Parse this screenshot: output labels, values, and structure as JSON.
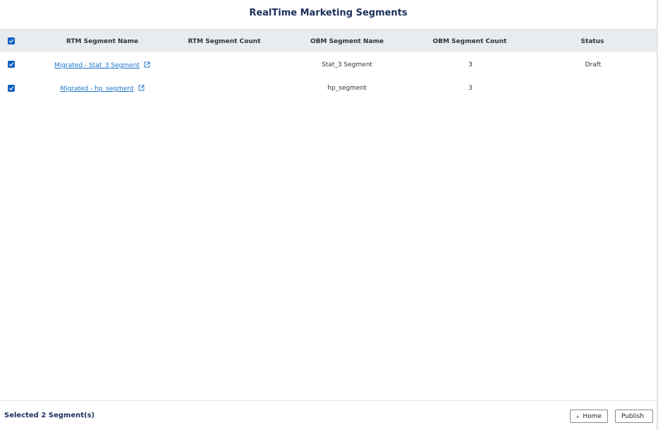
{
  "page": {
    "title": "RealTime Marketing Segments"
  },
  "table": {
    "columns": [
      "RTM Segment Name",
      "RTM Segment Count",
      "OBM Segment Name",
      "OBM Segment Count",
      "Status"
    ],
    "rows": [
      {
        "rtm_name": "Migrated - Stat_3 Segment",
        "rtm_count": "",
        "obm_name": "Stat_3 Segment",
        "obm_count": "3",
        "status": "Draft",
        "checked": true
      },
      {
        "rtm_name": "Migrated - hp_segment",
        "rtm_count": "",
        "obm_name": "hp_segment",
        "obm_count": "3",
        "status": "",
        "checked": true
      }
    ]
  },
  "footer": {
    "selected_text": "Selected 2 Segment(s)",
    "home_label": "Home",
    "publish_label": "Publish"
  },
  "icons": {
    "checkbox": "checkbox-checked-icon",
    "external": "external-link-icon",
    "home": "home-icon",
    "send": "send-icon"
  },
  "colors": {
    "accent": "#0f5fc3",
    "link": "#1a73c9",
    "title": "#1b2f5c",
    "header_bg": "#e8ecef"
  }
}
